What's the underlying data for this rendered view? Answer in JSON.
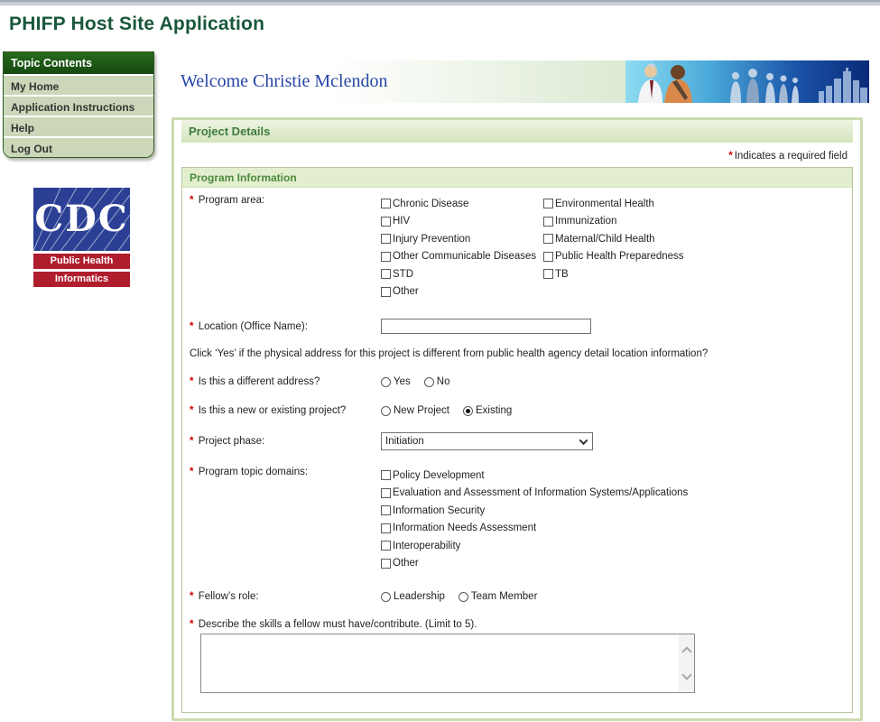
{
  "app": {
    "title": "PHIFP Host Site Application"
  },
  "sidebar": {
    "header": "Topic Contents",
    "items": [
      {
        "label": "My Home"
      },
      {
        "label": "Application Instructions"
      },
      {
        "label": "Help"
      },
      {
        "label": "Log Out"
      }
    ]
  },
  "logo": {
    "acronym": "CDC",
    "line1": "Public Health",
    "line2": "Informatics"
  },
  "banner": {
    "welcome": "Welcome Christie Mclendon"
  },
  "page": {
    "section_title": "Project Details",
    "required_marker": "*",
    "required_note": "Indicates a required field"
  },
  "form": {
    "group_title": "Program Information",
    "program_area": {
      "label": "Program area:",
      "col1": [
        "Chronic Disease",
        "HIV",
        "Injury Prevention",
        "Other Communicable Diseases",
        "STD",
        "Other"
      ],
      "col2": [
        "Environmental Health",
        "Immunization",
        "Maternal/Child Health",
        "Public Health Preparedness",
        "TB"
      ]
    },
    "location": {
      "label": "Location (Office Name):",
      "value": ""
    },
    "address_note": "Click ‘Yes’ if the physical address for this project is different from public health agency detail location information?",
    "different_address": {
      "label": "Is this a different address?",
      "options": [
        "Yes",
        "No"
      ],
      "selected": null
    },
    "new_or_existing": {
      "label": "Is this a new or existing project?",
      "options": [
        "New Project",
        "Existing"
      ],
      "selected": "Existing"
    },
    "project_phase": {
      "label": "Project phase:",
      "value": "Initiation"
    },
    "topic_domains": {
      "label": "Program topic domains:",
      "items": [
        "Policy Development",
        "Evaluation and Assessment of Information Systems/Applications",
        "Information Security",
        "Information Needs Assessment",
        "Interoperability",
        "Other"
      ]
    },
    "fellows_role": {
      "label": "Fellow’s role:",
      "options": [
        "Leadership",
        "Team Member"
      ],
      "selected": null
    },
    "skills": {
      "label": "Describe the skills a fellow must have/contribute. (Limit to 5).",
      "value": ""
    }
  },
  "colors": {
    "title_green": "#19573b",
    "sidebar_header_green": "#1c5713",
    "sidebar_item_green": "#cbd7b8",
    "section_bar_green": "#d5e4bd",
    "group_bar_green": "#e3eecf",
    "header_text_green": "#3e7b3e",
    "required_red": "#cc0000",
    "welcome_blue": "#2746a8",
    "cdc_blue": "#2b3f94",
    "cdc_red": "#b01e2e",
    "panel_border_green": "#ccdab1"
  }
}
